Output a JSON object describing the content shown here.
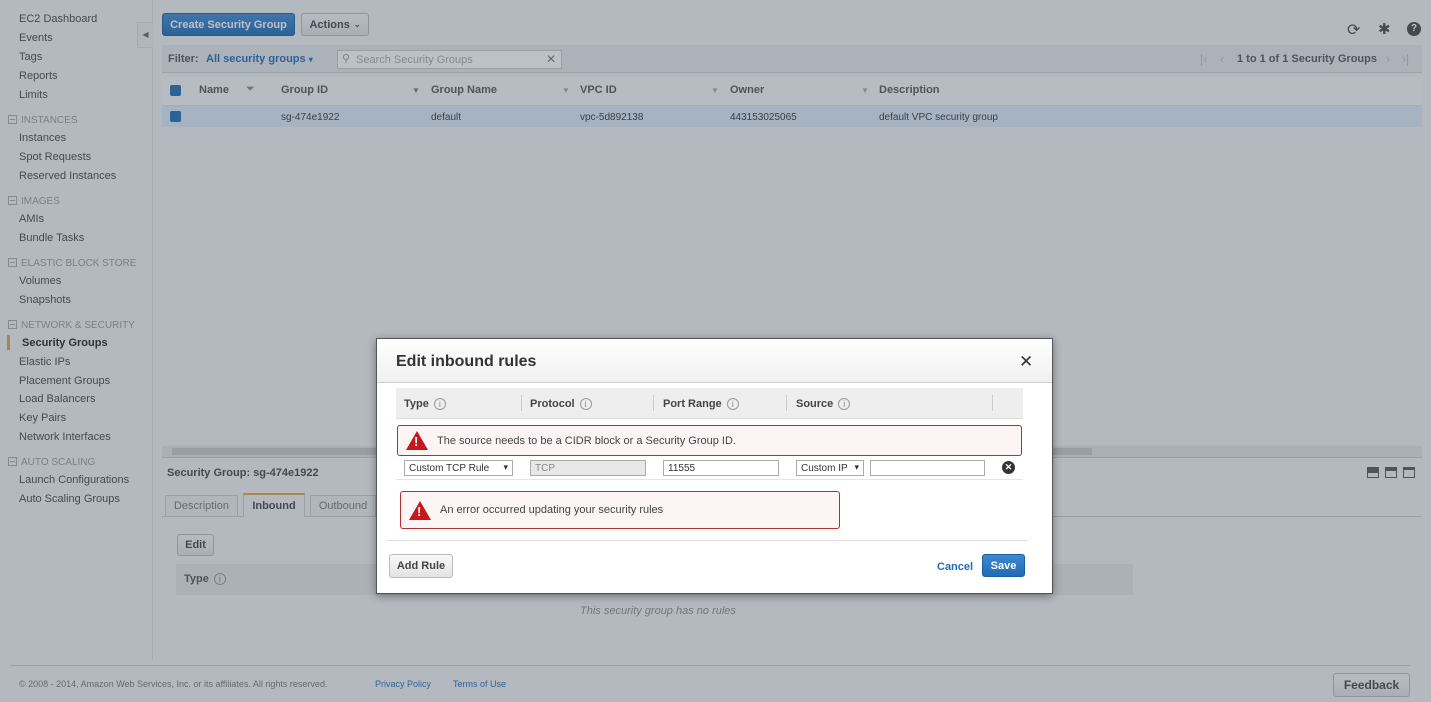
{
  "sidebar": {
    "top": [
      "EC2 Dashboard",
      "Events",
      "Tags",
      "Reports",
      "Limits"
    ],
    "sections": [
      {
        "title": "INSTANCES",
        "items": [
          "Instances",
          "Spot Requests",
          "Reserved Instances"
        ]
      },
      {
        "title": "IMAGES",
        "items": [
          "AMIs",
          "Bundle Tasks"
        ]
      },
      {
        "title": "ELASTIC BLOCK STORE",
        "items": [
          "Volumes",
          "Snapshots"
        ]
      },
      {
        "title": "NETWORK & SECURITY",
        "items": [
          "Security Groups",
          "Elastic IPs",
          "Placement Groups",
          "Load Balancers",
          "Key Pairs",
          "Network Interfaces"
        ]
      },
      {
        "title": "AUTO SCALING",
        "items": [
          "Launch Configurations",
          "Auto Scaling Groups"
        ]
      }
    ],
    "active": "Security Groups"
  },
  "toolbar": {
    "create": "Create Security Group",
    "actions": "Actions"
  },
  "filter": {
    "label": "Filter:",
    "value": "All security groups",
    "search_placeholder": "Search Security Groups",
    "pagination": "1 to 1 of 1 Security Groups"
  },
  "table": {
    "columns": [
      "Name",
      "Group ID",
      "Group Name",
      "VPC ID",
      "Owner",
      "Description"
    ],
    "rows": [
      {
        "name": "",
        "group_id": "sg-474e1922",
        "group_name": "default",
        "vpc_id": "vpc-5d892138",
        "owner": "443153025065",
        "description": "default VPC security group"
      }
    ]
  },
  "details": {
    "title": "Security Group: sg-474e1922",
    "tabs": [
      "Description",
      "Inbound",
      "Outbound"
    ],
    "active_tab": "Inbound",
    "edit": "Edit",
    "type_col": "Type",
    "empty": "This security group has no rules"
  },
  "footer": {
    "copyright": "© 2008 - 2014, Amazon Web Services, Inc. or its affiliates. All rights reserved.",
    "privacy": "Privacy Policy",
    "terms": "Terms of Use",
    "feedback": "Feedback"
  },
  "modal": {
    "title": "Edit inbound rules",
    "columns": [
      "Type",
      "Protocol",
      "Port Range",
      "Source"
    ],
    "source_error": "The source needs to be a CIDR block or a Security Group ID.",
    "rule": {
      "type": "Custom TCP Rule",
      "protocol": "TCP",
      "port_range": "11555",
      "source_type": "Custom IP",
      "source_value": ""
    },
    "update_error": "An error occurred updating your security rules",
    "add_rule": "Add Rule",
    "cancel": "Cancel",
    "save": "Save"
  },
  "colors": {
    "primary": "#1f6bb5",
    "error": "#c8161d",
    "active_nav": "#e7a23a"
  }
}
